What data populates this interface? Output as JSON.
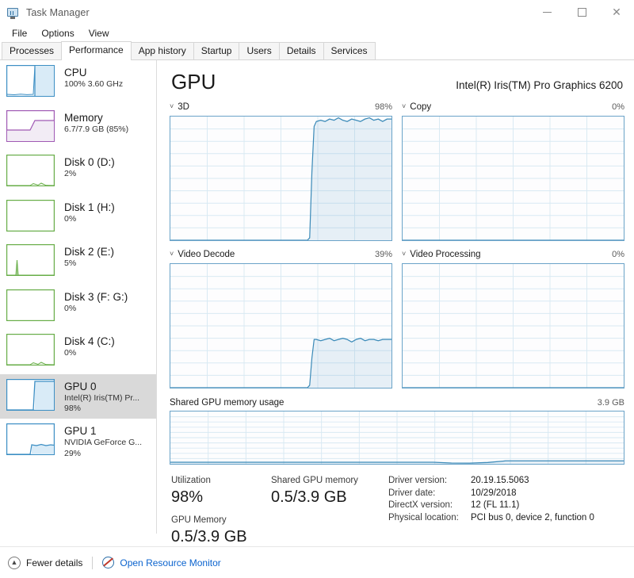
{
  "window": {
    "title": "Task Manager",
    "icon": "task-manager-icon",
    "minimize_label": "—",
    "maximize_label": "□",
    "close_label": "✕"
  },
  "menubar": {
    "items": [
      "File",
      "Options",
      "View"
    ]
  },
  "tabs": {
    "items": [
      "Processes",
      "Performance",
      "App history",
      "Startup",
      "Users",
      "Details",
      "Services"
    ],
    "active": "Performance"
  },
  "sidebar": {
    "items": [
      {
        "title": "CPU",
        "sub": "100%  3.60 GHz",
        "color": "#3d8fc4",
        "fill": "#d9ebf7",
        "selected": false,
        "kind": "cpu"
      },
      {
        "title": "Memory",
        "sub": "6.7/7.9 GB (85%)",
        "color": "#a05ab4",
        "fill": "#f2ecf5",
        "selected": false,
        "kind": "memory"
      },
      {
        "title": "Disk 0 (D:)",
        "sub": "2%",
        "color": "#67ad47",
        "fill": "#eef7e9",
        "selected": false,
        "kind": "disk-low"
      },
      {
        "title": "Disk 1 (H:)",
        "sub": "0%",
        "color": "#67ad47",
        "fill": "#eef7e9",
        "selected": false,
        "kind": "disk-zero"
      },
      {
        "title": "Disk 2 (E:)",
        "sub": "5%",
        "color": "#67ad47",
        "fill": "#eef7e9",
        "selected": false,
        "kind": "disk-spike"
      },
      {
        "title": "Disk 3 (F: G:)",
        "sub": "0%",
        "color": "#67ad47",
        "fill": "#eef7e9",
        "selected": false,
        "kind": "disk-zero"
      },
      {
        "title": "Disk 4 (C:)",
        "sub": "0%",
        "color": "#67ad47",
        "fill": "#eef7e9",
        "selected": false,
        "kind": "disk-low"
      },
      {
        "title": "GPU 0",
        "sub": "Intel(R) Iris(TM) Pr...",
        "sub2": "98%",
        "color": "#3d8fc4",
        "fill": "#d9ebf7",
        "selected": true,
        "kind": "gpu-high"
      },
      {
        "title": "GPU 1",
        "sub": "NVIDIA GeForce G...",
        "sub2": "29%",
        "color": "#3d8fc4",
        "fill": "#d9ebf7",
        "selected": false,
        "kind": "gpu-mid"
      }
    ]
  },
  "main": {
    "title": "GPU",
    "device": "Intel(R) Iris(TM) Pro Graphics 6200",
    "chevron": "˅",
    "graphs": [
      {
        "name": "3D",
        "value": "98%"
      },
      {
        "name": "Copy",
        "value": "0%"
      },
      {
        "name": "Video Decode",
        "value": "39%"
      },
      {
        "name": "Video Processing",
        "value": "0%"
      }
    ],
    "shared": {
      "label": "Shared GPU memory usage",
      "max": "3.9 GB"
    },
    "stats": [
      {
        "label": "Utilization",
        "value": "98%"
      },
      {
        "label": "GPU Memory",
        "value": "0.5/3.9 GB"
      },
      {
        "label": "Shared GPU memory",
        "value": "0.5/3.9 GB"
      }
    ],
    "info": [
      {
        "key": "Driver version:",
        "value": "20.19.15.5063"
      },
      {
        "key": "Driver date:",
        "value": "10/29/2018"
      },
      {
        "key": "DirectX version:",
        "value": "12 (FL 11.1)"
      },
      {
        "key": "Physical location:",
        "value": "PCI bus 0, device 2, function 0"
      }
    ]
  },
  "statusbar": {
    "fewer_details": "Fewer details",
    "fewer_icon": "⌃",
    "resource_monitor": "Open Resource Monitor",
    "resource_icon": "resource-monitor-icon"
  },
  "chart_data": [
    {
      "type": "area",
      "title": "3D",
      "ylabel": "Utilization",
      "ylim": [
        0,
        100
      ],
      "grid": true,
      "value_now": 98,
      "unit": "%",
      "x": [
        0,
        8,
        16,
        24,
        32,
        40,
        48,
        56,
        60,
        62,
        63,
        64,
        65,
        66,
        68,
        70,
        72,
        74,
        76,
        78,
        80,
        82,
        84,
        86,
        88,
        90,
        92,
        94,
        96,
        98,
        100
      ],
      "values": [
        0,
        0,
        0,
        0,
        0,
        0,
        0,
        0,
        0,
        0,
        2,
        55,
        92,
        96,
        97,
        96,
        98,
        97,
        99,
        97,
        96,
        98,
        97,
        96,
        98,
        99,
        97,
        98,
        96,
        98,
        98
      ]
    },
    {
      "type": "area",
      "title": "Copy",
      "ylabel": "Utilization",
      "ylim": [
        0,
        100
      ],
      "grid": true,
      "value_now": 0,
      "unit": "%",
      "x": [
        0,
        20,
        40,
        60,
        80,
        100
      ],
      "values": [
        0,
        0,
        0,
        0,
        0,
        0
      ]
    },
    {
      "type": "area",
      "title": "Video Decode",
      "ylabel": "Utilization",
      "ylim": [
        0,
        100
      ],
      "grid": true,
      "value_now": 39,
      "unit": "%",
      "x": [
        0,
        8,
        16,
        24,
        32,
        40,
        48,
        56,
        60,
        62,
        63,
        64,
        65,
        66,
        68,
        70,
        72,
        74,
        76,
        78,
        80,
        82,
        84,
        86,
        88,
        90,
        92,
        94,
        96,
        98,
        100
      ],
      "values": [
        0,
        0,
        0,
        0,
        0,
        0,
        0,
        0,
        0,
        0,
        2,
        24,
        39,
        39,
        38,
        39,
        40,
        38,
        39,
        40,
        39,
        37,
        39,
        40,
        38,
        39,
        39,
        38,
        39,
        39,
        39
      ]
    },
    {
      "type": "area",
      "title": "Video Processing",
      "ylabel": "Utilization",
      "ylim": [
        0,
        100
      ],
      "grid": true,
      "value_now": 0,
      "unit": "%",
      "x": [
        0,
        20,
        40,
        60,
        80,
        100
      ],
      "values": [
        0,
        0,
        0,
        0,
        0,
        0
      ]
    },
    {
      "type": "area",
      "title": "Shared GPU memory usage",
      "ylabel": "GB",
      "ylim": [
        0,
        3.9
      ],
      "grid": true,
      "value_now": 0.5,
      "unit": "GB",
      "x": [
        0,
        10,
        20,
        30,
        40,
        50,
        58,
        62,
        66,
        70,
        74,
        78,
        84,
        90,
        96,
        100
      ],
      "values": [
        0.12,
        0.12,
        0.12,
        0.12,
        0.12,
        0.12,
        0.12,
        0.06,
        0.05,
        0.1,
        0.22,
        0.22,
        0.22,
        0.22,
        0.22,
        0.22
      ]
    }
  ]
}
